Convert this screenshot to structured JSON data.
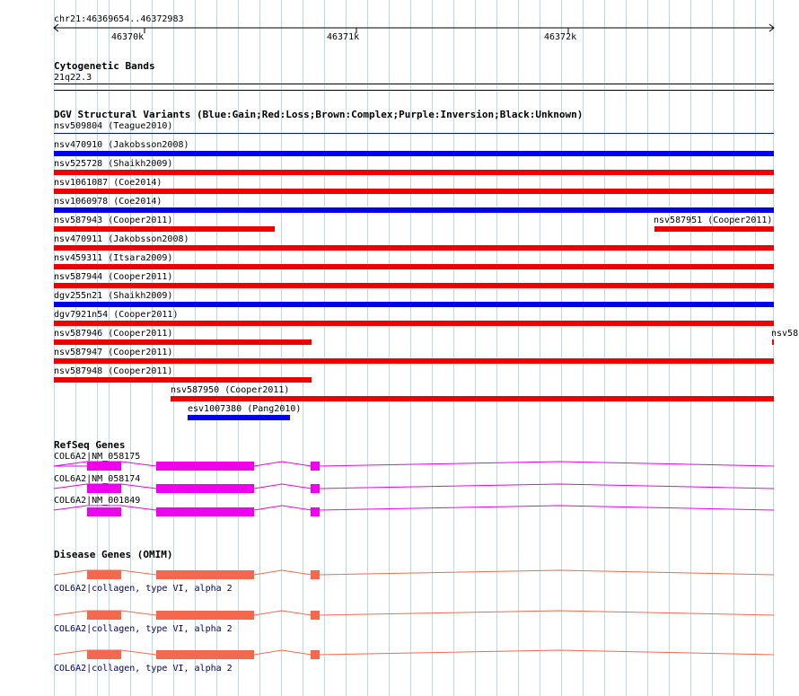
{
  "ruler": {
    "region": "chr21:46369654..46372983",
    "ticks": [
      "46370k",
      "46371k",
      "46372k"
    ]
  },
  "cytobands": {
    "title": "Cytogenetic Bands",
    "band": "21q22.3"
  },
  "dgv": {
    "title": "DGV Structural Variants (Blue:Gain;Red:Loss;Brown:Complex;Purple:Inversion;Black:Unknown)",
    "colors": {
      "gain": "#0000ee",
      "loss": "#ee0000"
    },
    "variants": [
      {
        "label": "nsv509804 (Teague2010)",
        "type": "gain"
      },
      {
        "label": "nsv470910 (Jakobsson2008)",
        "type": "gain"
      },
      {
        "label": "nsv525728 (Shaikh2009)",
        "type": "loss"
      },
      {
        "label": "nsv1061087 (Coe2014)",
        "type": "loss"
      },
      {
        "label": "nsv1060978 (Coe2014)",
        "type": "gain"
      },
      {
        "label": "nsv587943 (Cooper2011)",
        "type": "loss"
      },
      {
        "label": "nsv587951 (Cooper2011)",
        "type": "loss"
      },
      {
        "label": "nsv470911 (Jakobsson2008)",
        "type": "loss"
      },
      {
        "label": "nsv459311 (Itsara2009)",
        "type": "loss"
      },
      {
        "label": "nsv587944 (Cooper2011)",
        "type": "loss"
      },
      {
        "label": "dgv255n21 (Shaikh2009)",
        "type": "gain"
      },
      {
        "label": "dgv7921n54 (Cooper2011)",
        "type": "loss"
      },
      {
        "label": "nsv587946 (Cooper2011)",
        "type": "loss"
      },
      {
        "label": "nsv58",
        "type": "loss"
      },
      {
        "label": "nsv587947 (Cooper2011)",
        "type": "loss"
      },
      {
        "label": "nsv587948 (Cooper2011)",
        "type": "loss"
      },
      {
        "label": "nsv587950 (Cooper2011)",
        "type": "loss"
      },
      {
        "label": "esv1007380 (Pang2010)",
        "type": "gain"
      }
    ]
  },
  "refseq": {
    "title": "RefSeq Genes",
    "color": "#ee00ee",
    "genes": [
      {
        "label": "COL6A2|NM_058175"
      },
      {
        "label": "COL6A2|NM_058174"
      },
      {
        "label": "COL6A2|NM_001849"
      }
    ]
  },
  "omim": {
    "title": "Disease Genes (OMIM)",
    "color": "#f4694e",
    "genes": [
      {
        "label": "COL6A2|collagen, type VI, alpha 2"
      },
      {
        "label": "COL6A2|collagen, type VI, alpha 2"
      },
      {
        "label": "COL6A2|collagen, type VI, alpha 2"
      }
    ]
  }
}
